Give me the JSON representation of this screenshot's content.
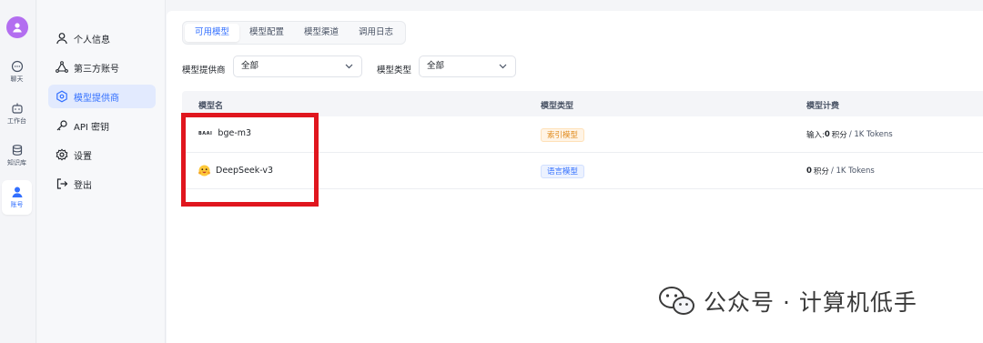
{
  "rail": {
    "items": [
      {
        "label": "聊天",
        "icon": "chat-icon"
      },
      {
        "label": "工作台",
        "icon": "robot-icon"
      },
      {
        "label": "知识库",
        "icon": "database-icon"
      },
      {
        "label": "账号",
        "icon": "user-icon",
        "active": true
      }
    ]
  },
  "menu": {
    "items": [
      {
        "label": "个人信息",
        "icon": "person-icon"
      },
      {
        "label": "第三方账号",
        "icon": "triangle-nodes-icon"
      },
      {
        "label": "模型提供商",
        "icon": "hexagon-icon",
        "active": true
      },
      {
        "label": "API 密钥",
        "icon": "key-icon"
      },
      {
        "label": "设置",
        "icon": "gear-icon"
      },
      {
        "label": "登出",
        "icon": "logout-icon"
      }
    ]
  },
  "tabs": [
    "可用模型",
    "模型配置",
    "模型渠道",
    "调用日志"
  ],
  "filters": {
    "provider_label": "模型提供商",
    "provider_value": "全部",
    "type_label": "模型类型",
    "type_value": "全部"
  },
  "table": {
    "headers": [
      "模型名",
      "模型类型",
      "模型计费"
    ],
    "rows": [
      {
        "logo_text": "BAAI",
        "name": "bge-m3",
        "type": "索引模型",
        "price_prefix": "输入:",
        "price_value": "0",
        "price_unit_word": "积分",
        "price_suffix": "/ 1K Tokens"
      },
      {
        "logo_text": "",
        "name": "DeepSeek-v3",
        "type": "语言模型",
        "price_prefix": "",
        "price_value": "0",
        "price_unit_word": "积分",
        "price_suffix": "/ 1K Tokens"
      }
    ]
  },
  "watermark": {
    "text": "公众号 · 计算机低手"
  },
  "colors": {
    "accent": "#3370ff",
    "highlight": "#e0161e",
    "avatar": "#b36ef0"
  }
}
